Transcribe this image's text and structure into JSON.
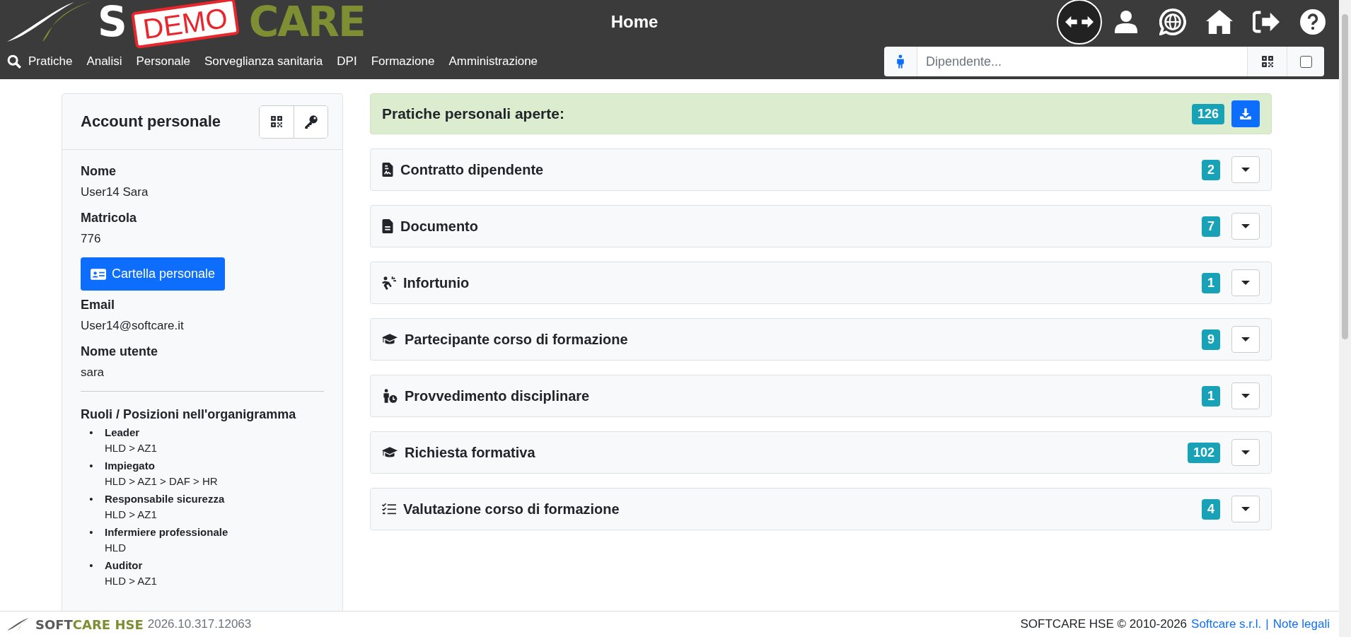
{
  "header": {
    "logo": {
      "left": "S",
      "stamp": "DEMO",
      "right": "CARE"
    },
    "title": "Home",
    "actions": [
      {
        "kind": "swap",
        "selected": true
      },
      {
        "kind": "user",
        "selected": false
      },
      {
        "kind": "globe",
        "selected": false
      },
      {
        "kind": "home",
        "selected": false
      },
      {
        "kind": "logout",
        "selected": false
      },
      {
        "kind": "help",
        "selected": false
      }
    ]
  },
  "nav": {
    "items": [
      "Pratiche",
      "Analisi",
      "Personale",
      "Sorveglianza sanitaria",
      "DPI",
      "Formazione",
      "Amministrazione"
    ],
    "search": {
      "placeholder": "Dipendente...",
      "checked": false
    }
  },
  "account": {
    "title": "Account personale",
    "rows": [
      {
        "kind": "field",
        "label": "Nome",
        "value": "User14 Sara"
      },
      {
        "kind": "field",
        "label": "Matricola",
        "value": "776"
      },
      {
        "kind": "button",
        "label": "Cartella personale"
      },
      {
        "kind": "field",
        "label": "Email",
        "value": "User14@softcare.it"
      },
      {
        "kind": "field",
        "label": "Nome utente",
        "value": "sara"
      }
    ],
    "roles_title": "Ruoli / Posizioni nell'organigramma",
    "roles": [
      {
        "marker": "•",
        "name": "Leader",
        "path": "HLD > AZ1"
      },
      {
        "marker": "•",
        "name": "Impiegato",
        "path": "HLD > AZ1 > DAF > HR"
      },
      {
        "marker": "•",
        "name": "Responsabile sicurezza",
        "path": "HLD > AZ1"
      },
      {
        "marker": "•",
        "name": "Infermiere professionale",
        "path": "HLD"
      },
      {
        "marker": "•",
        "name": "Auditor",
        "path": "HLD > AZ1"
      }
    ]
  },
  "practices": {
    "title": "Pratiche personali aperte:",
    "count": "126",
    "sections": [
      {
        "kind": "contract",
        "label": "Contratto dipendente",
        "count": "2"
      },
      {
        "kind": "document",
        "label": "Documento",
        "count": "7"
      },
      {
        "kind": "accident",
        "label": "Infortunio",
        "count": "1"
      },
      {
        "kind": "graduation",
        "label": "Partecipante corso di formazione",
        "count": "9"
      },
      {
        "kind": "disciplinary",
        "label": "Provvedimento disciplinare",
        "count": "1"
      },
      {
        "kind": "graduation",
        "label": "Richiesta formativa",
        "count": "102"
      },
      {
        "kind": "checklist",
        "label": "Valutazione corso di formazione",
        "count": "4"
      }
    ]
  },
  "footer": {
    "logo_first": "SOFT",
    "logo_second": "CARE HSE",
    "version": "2026.10.317.12063",
    "copyright": "SOFTCARE HSE © 2010-2026",
    "company_link": "Softcare s.r.l.",
    "separator": "|",
    "legal_link": "Note legali"
  }
}
